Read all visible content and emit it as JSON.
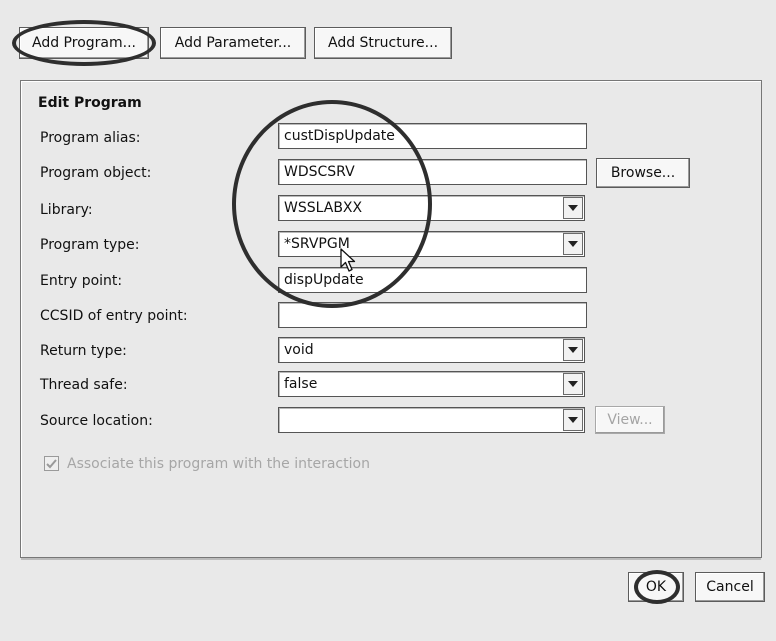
{
  "toolbar": {
    "add_program": "Add Program...",
    "add_parameter": "Add Parameter...",
    "add_structure": "Add Structure..."
  },
  "edit_program": {
    "title": "Edit Program",
    "fields": {
      "program_alias": {
        "label": "Program alias:",
        "value": "custDispUpdate"
      },
      "program_object": {
        "label": "Program object:",
        "value": "WDSCSRV"
      },
      "library": {
        "label": "Library:",
        "value": "WSSLABXX"
      },
      "program_type": {
        "label": "Program type:",
        "value": "*SRVPGM"
      },
      "entry_point": {
        "label": "Entry point:",
        "value": "dispUpdate"
      },
      "ccsid": {
        "label": "CCSID of entry point:",
        "value": ""
      },
      "return_type": {
        "label": "Return type:",
        "value": "void"
      },
      "thread_safe": {
        "label": "Thread safe:",
        "value": "false"
      },
      "source_location": {
        "label": "Source location:",
        "value": ""
      }
    },
    "browse_button": "Browse...",
    "view_button": "View...",
    "associate_checkbox": {
      "label": "Associate this program with the interaction",
      "checked": true,
      "enabled": false
    }
  },
  "footer": {
    "ok": "OK",
    "cancel": "Cancel"
  },
  "icons": {
    "dropdown": "chevron-down-icon",
    "cursor": "mouse-pointer-icon",
    "check": "checkmark-icon"
  },
  "colors": {
    "background": "#e9e9e9",
    "annotation_ring": "#2e2e2e",
    "disabled_text": "#a6a6a6"
  }
}
